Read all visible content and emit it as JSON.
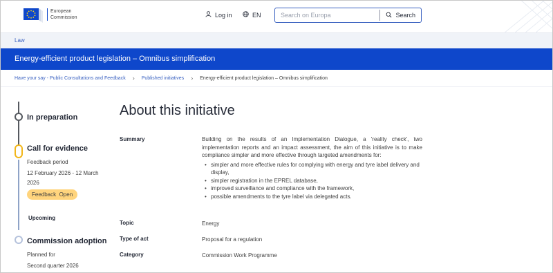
{
  "header": {
    "logo_line1": "European",
    "logo_line2": "Commission",
    "login_label": "Log in",
    "language_label": "EN",
    "search_placeholder": "Search on Europa",
    "search_button_label": "Search"
  },
  "subnav": {
    "link_label": "Law"
  },
  "banner": {
    "title": "Energy-efficient product legislation – Omnibus simplification"
  },
  "breadcrumb": [
    "Have your say - Public Consultations and Feedback",
    "Published initiatives",
    "Energy-efficient product legislation – Omnibus simplification"
  ],
  "timeline": {
    "stages": [
      {
        "title": "In preparation"
      },
      {
        "title": "Call for evidence",
        "subtitle": "Feedback period",
        "dates_line1": "12 February 2026 - 12 March",
        "dates_line2": "2026",
        "badge": "Feedback  Open"
      },
      {
        "title": "Upcoming"
      },
      {
        "title": "Commission adoption",
        "subtitle": "Planned for",
        "dates_line1": "Second quarter 2026"
      }
    ]
  },
  "initiative": {
    "heading": "About this initiative",
    "summary_label": "Summary",
    "summary_text": "Building on the results of an Implementation Dialogue, a 'reality check', two implementation reports and an impact assessment, the aim of this initiative is to make compliance simpler and more effective through targeted amendments for:",
    "summary_bullets": [
      "simpler and more effective rules for complying with energy and tyre label delivery and display,",
      "simpler registration in the EPREL database,",
      "improved surveillance and compliance with the framework,",
      "possible amendments to the tyre label via delegated acts."
    ],
    "topic_label": "Topic",
    "topic_value": "Energy",
    "type_label": "Type of act",
    "type_value": "Proposal for a regulation",
    "category_label": "Category",
    "category_value": "Commission Work Programme"
  },
  "colors": {
    "primary_blue": "#0e47cb",
    "badge_yellow": "#ffd47d",
    "active_stage": "#f2b619"
  }
}
